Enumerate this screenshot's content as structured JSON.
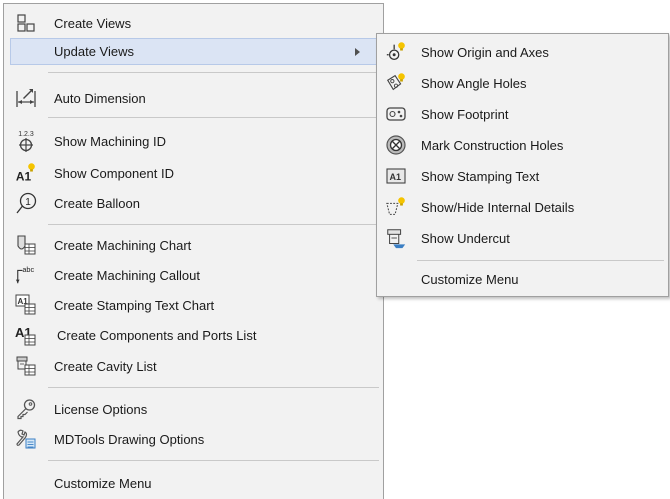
{
  "main_menu": {
    "items": [
      {
        "label": "Create Views",
        "icon": "create-views-icon"
      },
      {
        "label": "Update Views",
        "icon": "none",
        "submenu": true
      },
      {
        "label": "Auto Dimension",
        "icon": "auto-dimension-icon"
      },
      {
        "label": "Show Machining ID",
        "icon": "machining-id-icon"
      },
      {
        "label": "Show Component ID",
        "icon": "component-id-icon"
      },
      {
        "label": "Create Balloon",
        "icon": "balloon-icon"
      },
      {
        "label": "Create Machining Chart",
        "icon": "machining-chart-icon"
      },
      {
        "label": "Create Machining Callout",
        "icon": "machining-callout-icon"
      },
      {
        "label": "Create Stamping Text Chart",
        "icon": "stamping-text-chart-icon"
      },
      {
        "label": "Create Components and Ports List",
        "icon": "components-ports-list-icon"
      },
      {
        "label": "Create Cavity List",
        "icon": "cavity-list-icon"
      },
      {
        "label": "License Options",
        "icon": "key-icon"
      },
      {
        "label": "MDTools Drawing Options",
        "icon": "wrench-icon"
      },
      {
        "label": "Customize Menu",
        "icon": "none"
      }
    ],
    "icon_texts": {
      "machining_id": "1.2.3",
      "component_id": "A1",
      "balloon": "1",
      "callout": "abc",
      "stamping_chart": "A1",
      "components_list": "A1"
    }
  },
  "sub_menu": {
    "items": [
      {
        "label": "Show Origin and  Axes",
        "icon": "origin-axes-icon"
      },
      {
        "label": "Show Angle Holes",
        "icon": "angle-holes-icon"
      },
      {
        "label": "Show Footprint",
        "icon": "footprint-icon"
      },
      {
        "label": "Mark Construction Holes",
        "icon": "construction-holes-icon"
      },
      {
        "label": "Show Stamping Text",
        "icon": "stamping-text-icon"
      },
      {
        "label": "Show/Hide Internal Details",
        "icon": "internal-details-icon"
      },
      {
        "label": "Show Undercut",
        "icon": "undercut-icon"
      },
      {
        "label": "Customize Menu",
        "icon": "none"
      }
    ],
    "icon_texts": {
      "stamping_text": "A1"
    }
  },
  "colors": {
    "menu_bg": "#f2f2f2",
    "highlight_bg": "#dbe4f4",
    "bulb_yellow": "#f5c400",
    "icon_blue": "#3b7fc4",
    "icon_gray": "#4a4a4a"
  }
}
